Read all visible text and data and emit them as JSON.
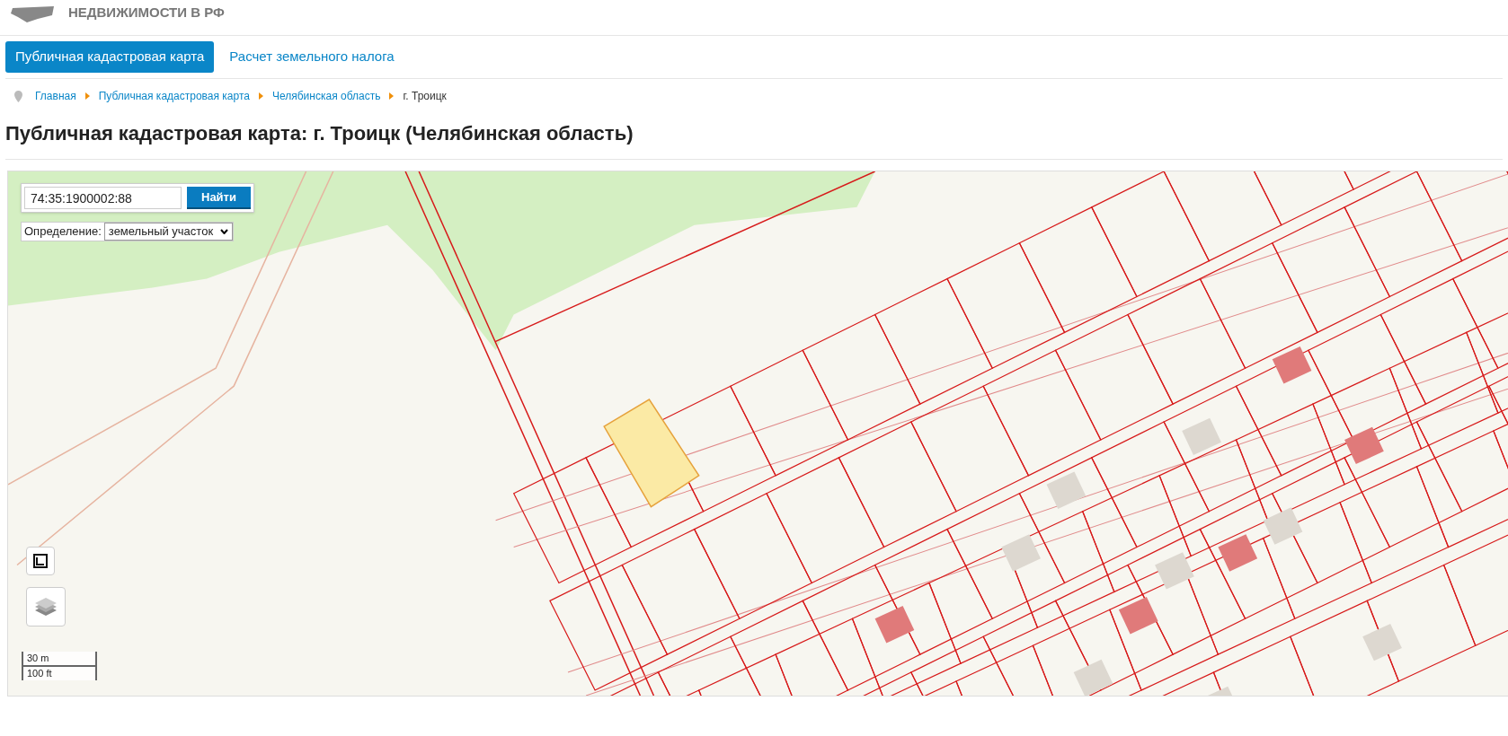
{
  "header": {
    "logo_text": "НЕДВИЖИМОСТИ В РФ"
  },
  "tabs": [
    {
      "label": "Публичная кадастровая карта",
      "selected": true
    },
    {
      "label": "Расчет земельного налога",
      "selected": false
    }
  ],
  "breadcrumbs": [
    {
      "label": "Главная",
      "link": true
    },
    {
      "label": "Публичная кадастровая карта",
      "link": true
    },
    {
      "label": "Челябинская область",
      "link": true
    },
    {
      "label": "г. Троицк",
      "link": false
    }
  ],
  "title": "Публичная кадастровая карта: г. Троицк (Челябинская область)",
  "map": {
    "search": {
      "value": "74:35:1900002:88",
      "button": "Найти"
    },
    "definition": {
      "label": "Определение:",
      "value": "земельный участок"
    },
    "scale": {
      "metric": "30 m",
      "imperial": "100 ft"
    }
  }
}
